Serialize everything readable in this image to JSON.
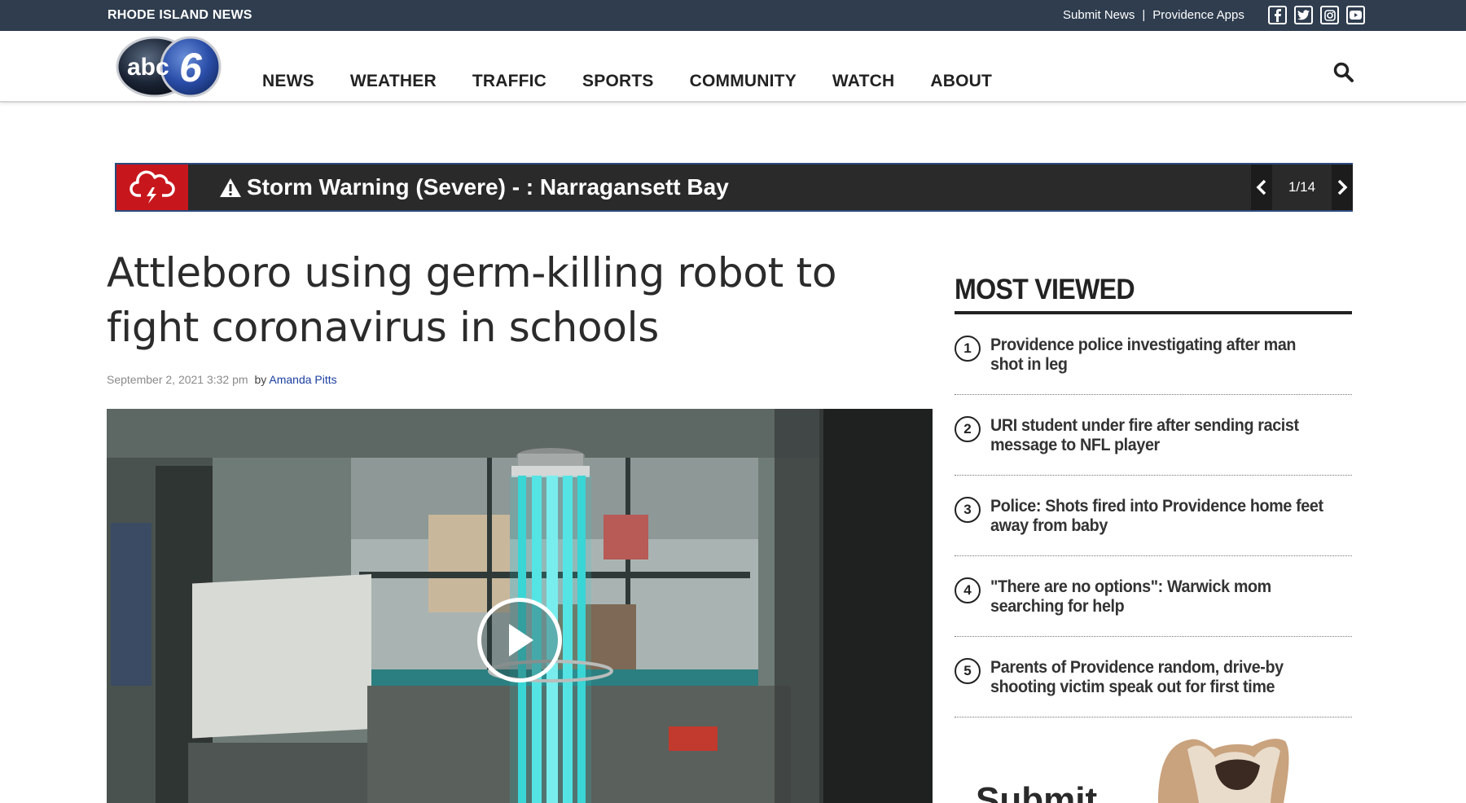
{
  "topbar": {
    "site_name": "RHODE ISLAND NEWS",
    "links": [
      "Submit News",
      "Providence Apps"
    ],
    "separator": "|",
    "social": [
      {
        "icon": "facebook-icon",
        "glyph": "f"
      },
      {
        "icon": "twitter-icon",
        "glyph": "t"
      },
      {
        "icon": "instagram-icon",
        "glyph": "◘"
      },
      {
        "icon": "youtube-icon",
        "glyph": "▶"
      }
    ]
  },
  "header": {
    "logo_text": "abc",
    "logo_number": "6",
    "nav": [
      "NEWS",
      "WEATHER",
      "TRAFFIC",
      "SPORTS",
      "COMMUNITY",
      "WATCH",
      "ABOUT"
    ]
  },
  "alert": {
    "icon": "storm-cloud-icon",
    "text": "Storm Warning (Severe) - : Narragansett Bay",
    "pager": "1/14",
    "colors": {
      "icon_bg": "#c8161d",
      "bar_bg": "#2a2a2a"
    }
  },
  "article": {
    "headline": "Attleboro using germ-killing robot to fight coronavirus in schools",
    "date": "September 2, 2021 3:32 pm",
    "by": "by",
    "author": "Amanda Pitts"
  },
  "sidebar": {
    "title": "MOST VIEWED",
    "items": [
      {
        "num": "1",
        "text": "Providence police investigating after man shot in leg"
      },
      {
        "num": "2",
        "text": "URI student under fire after sending racist message to NFL player"
      },
      {
        "num": "3",
        "text": "Police: Shots fired into Providence home feet away from baby"
      },
      {
        "num": "4",
        "text": "\"There are no options\": Warwick mom searching for help"
      },
      {
        "num": "5",
        "text": "Parents of Providence random, drive-by shooting victim speak out for first time"
      }
    ],
    "promo_text": "Submit"
  },
  "colors": {
    "topbar": "#2f3d4f",
    "author_link": "#1a3ea0"
  }
}
